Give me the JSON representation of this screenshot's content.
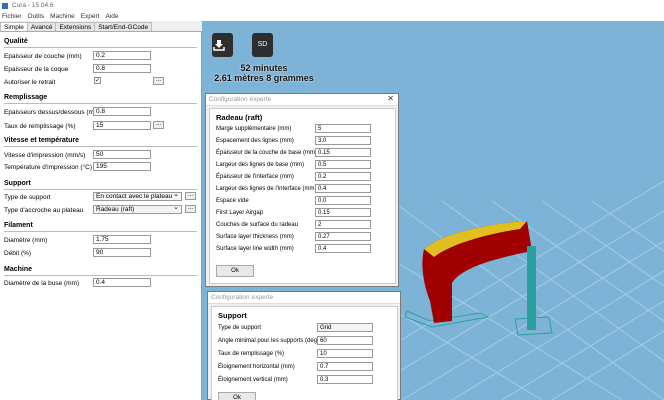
{
  "window": {
    "title": "Cura - 15.04.6"
  },
  "menu": [
    "Fichier",
    "Outils",
    "Machine",
    "Expert",
    "Aide"
  ],
  "tabs": [
    "Simple",
    "Avancé",
    "Extensions",
    "Start/End-GCode"
  ],
  "quality": {
    "title": "Qualité",
    "layer_height_label": "Epaisseur de couche (mm)",
    "layer_height": "0.2",
    "shell_label": "Epaisseur de la coque",
    "shell": "0.8",
    "retraction_label": "Autoriser le retrait",
    "retraction_checked": "✓",
    "dots": "..."
  },
  "fill": {
    "title": "Remplissage",
    "bottom_top_label": "Epaisseurs dessus/dessous (mm)",
    "bottom_top": "0.8",
    "density_label": "Taux de remplissage (%)",
    "density": "15",
    "dots": "..."
  },
  "speed": {
    "title": "Vitesse et température",
    "print_speed_label": "Vitesse d'impression (mm/s)",
    "print_speed": "50",
    "temp_label": "Température d'impression (°C)",
    "temp": "195"
  },
  "support": {
    "title": "Support",
    "type_label": "Type de support",
    "type": "En contact avec le plateau",
    "adhesion_label": "Type d'accroche au plateau",
    "adhesion": "Radeau (raft)",
    "dots": "..."
  },
  "filament": {
    "title": "Filament",
    "diameter_label": "Diamètre (mm)",
    "diameter": "1.75",
    "flow_label": "Débit (%)",
    "flow": "90"
  },
  "machine": {
    "title": "Machine",
    "nozzle_label": "Diamètre de la buse (mm)",
    "nozzle": "0.4"
  },
  "viewport": {
    "load_icon": "load-icon",
    "sd_label": "SD",
    "time": "52 minutes",
    "material": "2.61 mètres 8 grammes",
    "colors": {
      "background": "#7db3d6",
      "grid": "#a5cde8",
      "model": "#a00000",
      "model_top": "#e0c020",
      "support": "#2aa0a0"
    }
  },
  "raft_dialog": {
    "window_title": "Configuration experte",
    "close": "✕",
    "heading": "Radeau (raft)",
    "fields": [
      {
        "label": "Marge supplémentaire (mm)",
        "value": "5"
      },
      {
        "label": "Espacement des lignes (mm)",
        "value": "3.0"
      },
      {
        "label": "Épaisseur de la couche de base (mm)",
        "value": "0.15"
      },
      {
        "label": "Largeur des lignes de base (mm)",
        "value": "0.5"
      },
      {
        "label": "Épaisseur de l'interface (mm)",
        "value": "0.2"
      },
      {
        "label": "Largeur des lignes de l'interface (mm)",
        "value": "0.4"
      },
      {
        "label": "Espace vide",
        "value": "0.0"
      },
      {
        "label": "First Layer Airgap",
        "value": "0.15"
      },
      {
        "label": "Couches de surface du radeau",
        "value": "2"
      },
      {
        "label": "Surface layer thickness (mm)",
        "value": "0.27"
      },
      {
        "label": "Surface layer line width (mm)",
        "value": "0.4"
      }
    ],
    "ok": "Ok"
  },
  "support_dialog": {
    "window_title": "Configuration experte",
    "heading": "Support",
    "fields": [
      {
        "label": "Type de support",
        "value": "Grid"
      },
      {
        "label": "Angle minimal pour les supports (deg)",
        "value": "60"
      },
      {
        "label": "Taux de remplissage (%)",
        "value": "10"
      },
      {
        "label": "Éloignement horizontal (mm)",
        "value": "0.7"
      },
      {
        "label": "Éloignement vertical (mm)",
        "value": "0.3"
      }
    ],
    "ok": "Ok"
  }
}
